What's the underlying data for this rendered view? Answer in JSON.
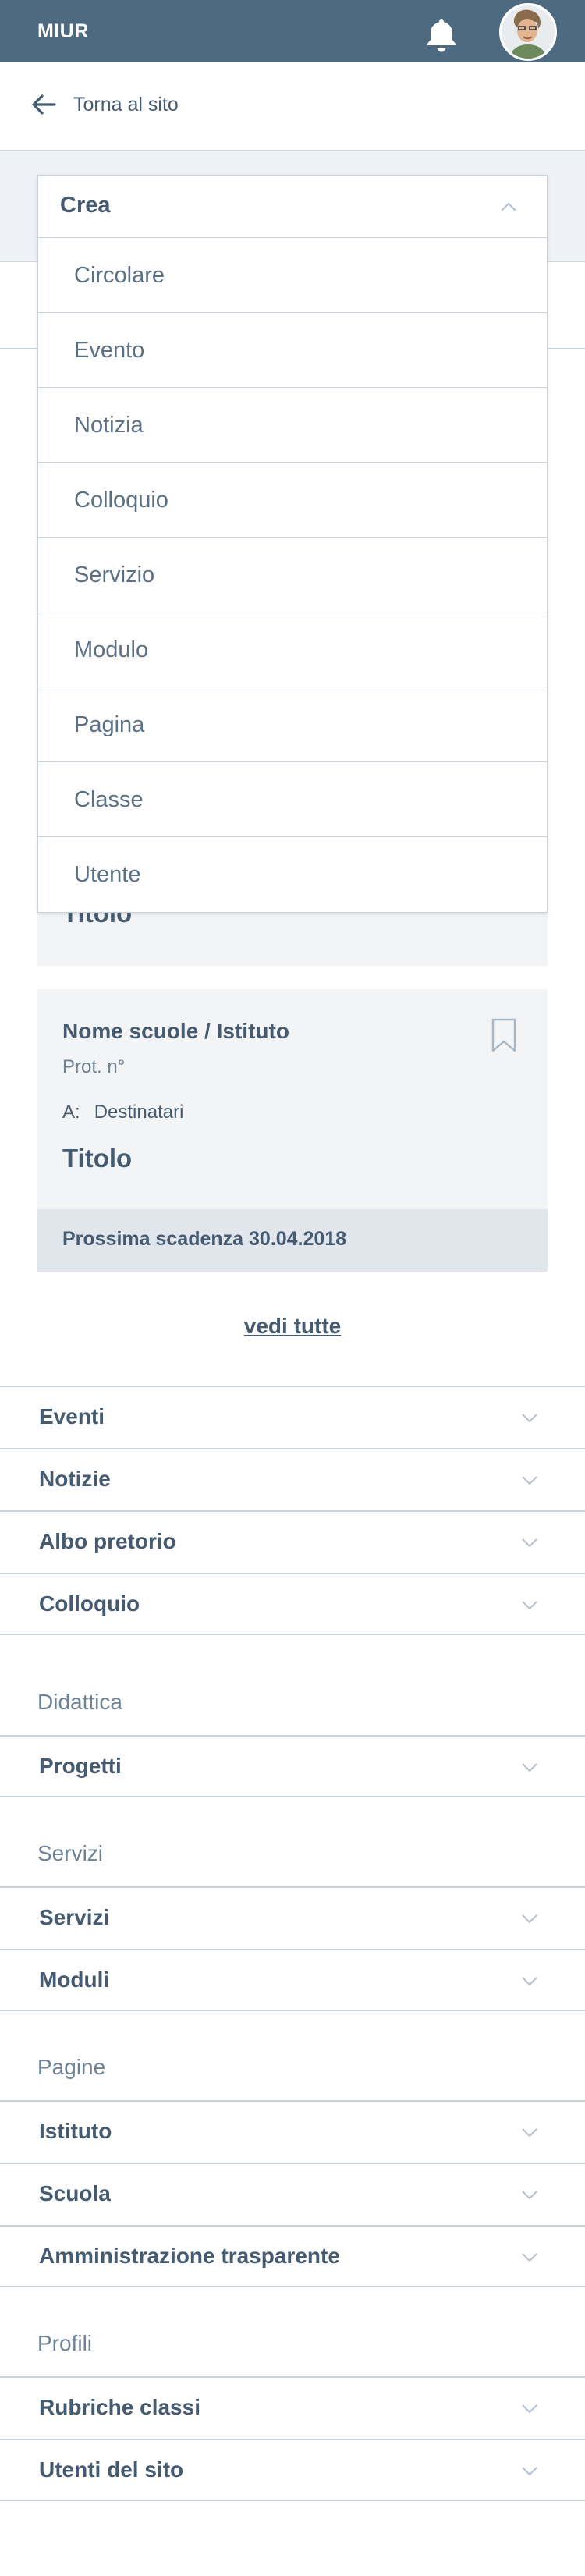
{
  "topbar": {
    "brand": "MIUR",
    "icons": [
      "bell-icon",
      "avatar"
    ]
  },
  "back": {
    "label": "Torna al sito",
    "icon": "arrow-left-icon"
  },
  "dropdown": {
    "label": "Crea",
    "expanded": true,
    "options": [
      "Circolare",
      "Evento",
      "Notizia",
      "Colloquio",
      "Servizio",
      "Modulo",
      "Pagina",
      "Classe",
      "Utente"
    ]
  },
  "cards": [
    {
      "title": "Titolo"
    },
    {
      "school": "Nome scuole / Istituto",
      "protocol": "Prot. n°",
      "recipients_prefix": "A:",
      "recipients": "Destinatari",
      "title": "Titolo",
      "deadline": "Prossima scadenza 30.04.2018",
      "icon": "bookmark-icon"
    }
  ],
  "see_all": "vedi tutte",
  "accordion": {
    "top": [
      "Eventi",
      "Notizie",
      "Albo pretorio",
      "Colloquio"
    ],
    "sections": [
      {
        "title": "Didattica",
        "items": [
          "Progetti"
        ]
      },
      {
        "title": "Servizi",
        "items": [
          "Servizi",
          "Moduli"
        ]
      },
      {
        "title": "Pagine",
        "items": [
          "Istituto",
          "Scuola",
          "Amministrazione trasparente"
        ]
      },
      {
        "title": "Profili",
        "items": [
          "Rubriche classi",
          "Utenti del sito"
        ]
      }
    ]
  }
}
